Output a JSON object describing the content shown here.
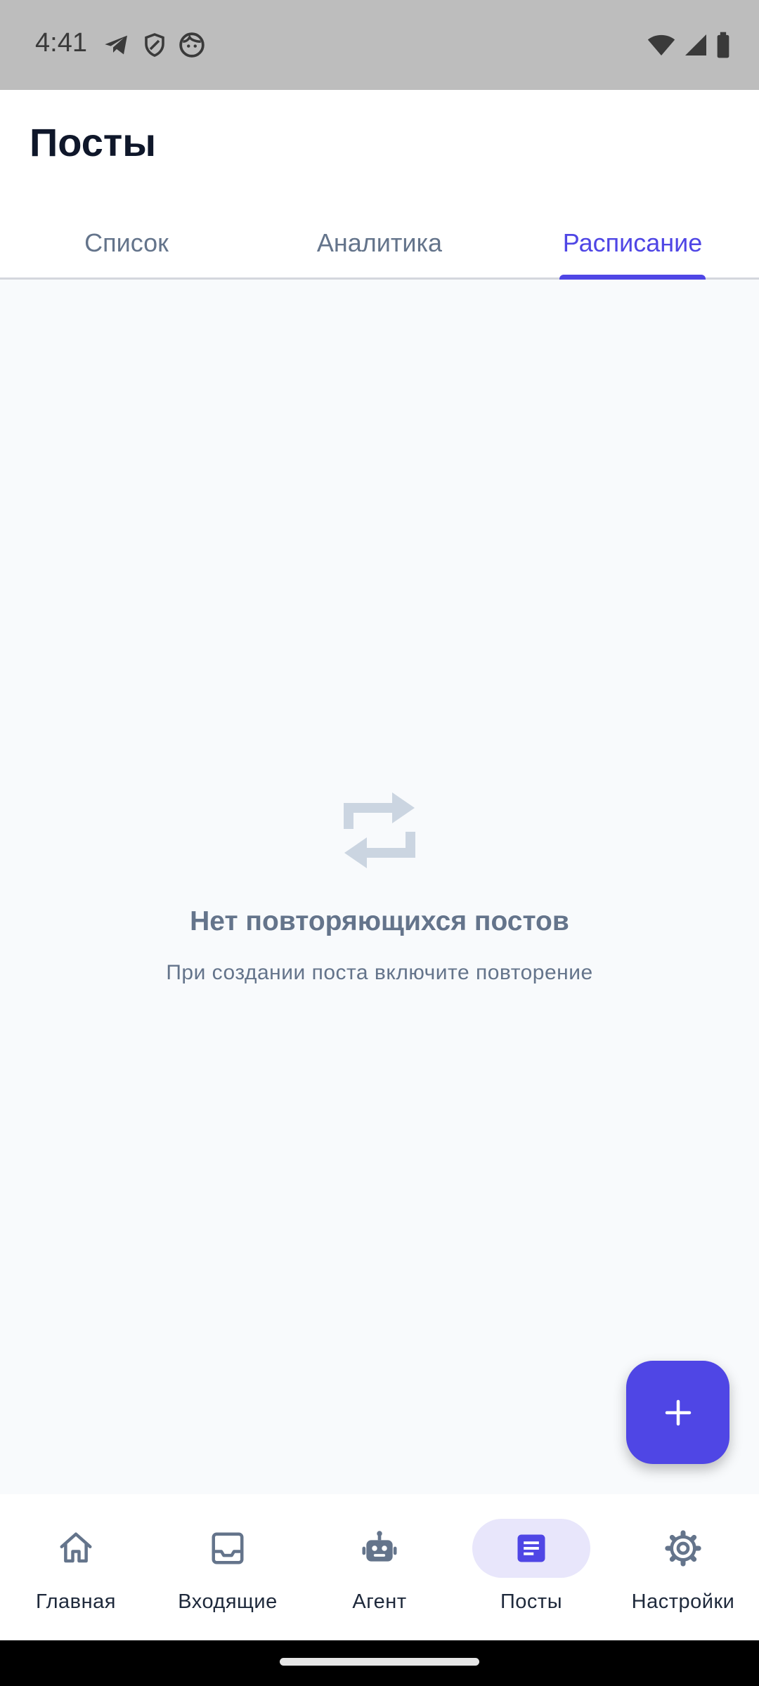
{
  "status_bar": {
    "time": "4:41",
    "left_icons": [
      "telegram-icon",
      "shield-icon",
      "face-icon"
    ],
    "right_icons": [
      "wifi-icon",
      "signal-icon",
      "battery-icon"
    ]
  },
  "header": {
    "title": "Посты"
  },
  "tabs": [
    {
      "label": "Список",
      "active": false
    },
    {
      "label": "Аналитика",
      "active": false
    },
    {
      "label": "Расписание",
      "active": true
    }
  ],
  "empty_state": {
    "icon": "repeat-icon",
    "title": "Нет повторяющихся постов",
    "subtitle": "При создании поста включите повторение"
  },
  "fab": {
    "icon": "plus-icon"
  },
  "bottom_nav": [
    {
      "label": "Главная",
      "icon": "home-icon",
      "active": false
    },
    {
      "label": "Входящие",
      "icon": "inbox-icon",
      "active": false
    },
    {
      "label": "Агент",
      "icon": "robot-icon",
      "active": false
    },
    {
      "label": "Посты",
      "icon": "document-icon",
      "active": true
    },
    {
      "label": "Настройки",
      "icon": "gear-icon",
      "active": false
    }
  ],
  "colors": {
    "accent": "#4f46e5",
    "accent_light": "#e8e6fb",
    "muted_text": "#64748b",
    "background": "#f8fafc",
    "status_bar": "#bdbdbd"
  }
}
